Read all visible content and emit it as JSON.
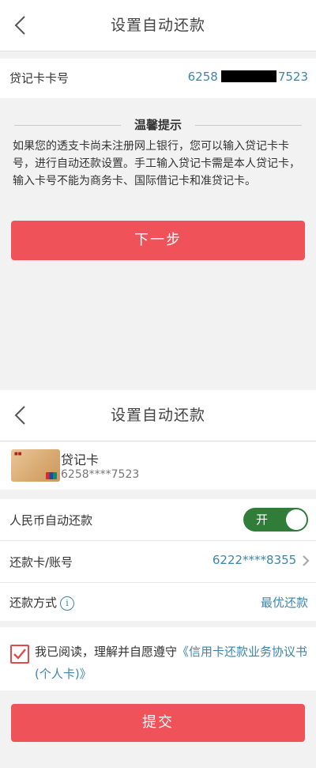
{
  "screen1": {
    "title": "设置自动还款",
    "debit_card_label": "贷记卡卡号",
    "debit_card_prefix": "6258",
    "debit_card_suffix": "7523",
    "tip_title": "温馨提示",
    "tip_text": "如果您的透支卡尚未注册网上银行，您可以输入贷记卡卡号，进行自动还款设置。手工输入贷记卡需是本人贷记卡，输入卡号不能为商务卡、国际借记卡和准贷记卡。",
    "next_button": "下一步"
  },
  "screen2": {
    "title": "设置自动还款",
    "card_name": "贷记卡",
    "card_number": "6258****7523",
    "auto_repay_label": "人民币自动还款",
    "toggle_text": "开",
    "toggle_on": true,
    "repay_account_label": "还款卡/账号",
    "repay_account_value": "6222****8355",
    "repay_method_label": "还款方式",
    "repay_method_value": "最优还款",
    "agree_text": "我已阅读，理解并自愿遵守",
    "agree_link": "《信用卡还款业务协议书(个人卡)》",
    "agree_checked": true,
    "submit_button": "提交"
  },
  "colors": {
    "accent_red": "#f0525a",
    "link_blue": "#3e86a9",
    "toggle_green": "#2f7d39"
  },
  "icons": [
    "back-arrow-icon",
    "info-icon",
    "chevron-right-icon",
    "checkmark-icon",
    "unionpay-icon"
  ]
}
